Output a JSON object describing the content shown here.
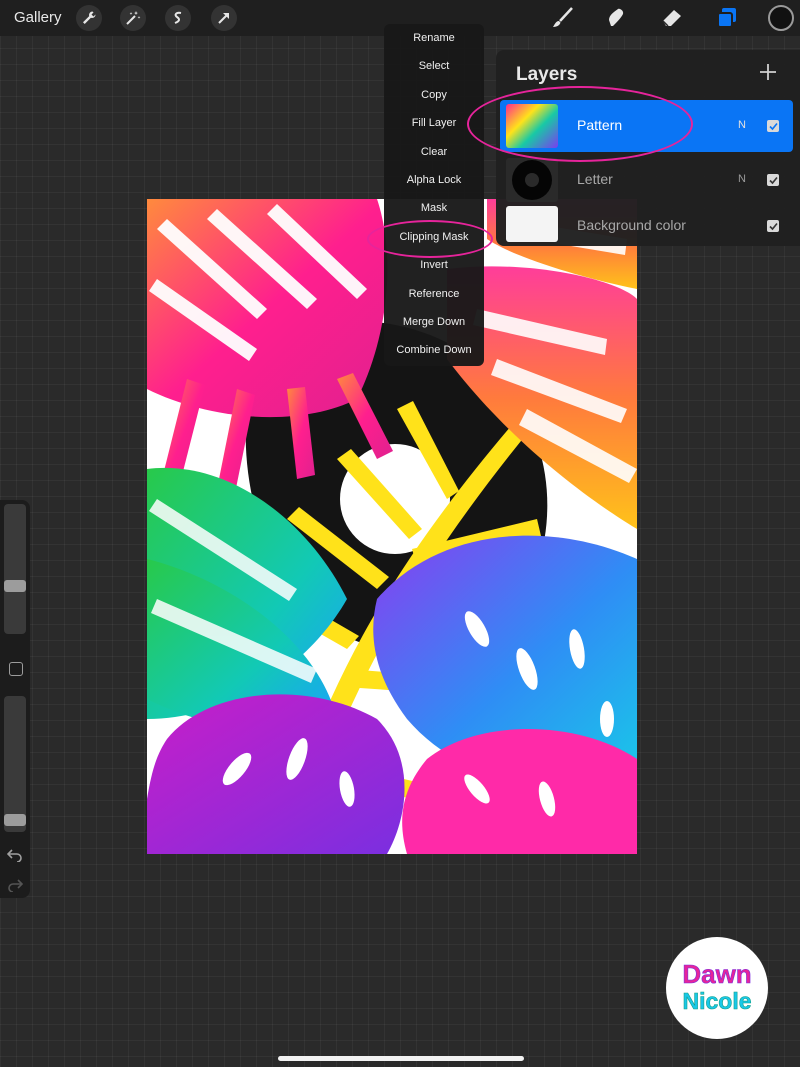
{
  "toolbar": {
    "gallery_label": "Gallery",
    "left_tools": [
      "wrench-icon",
      "magic-wand-icon",
      "selection-icon",
      "transform-arrow-icon"
    ],
    "right_tools": [
      "brush-icon",
      "smudge-icon",
      "eraser-icon",
      "layers-icon",
      "color-swatch"
    ],
    "active_color": "#111111"
  },
  "layer_menu": {
    "items": [
      "Rename",
      "Select",
      "Copy",
      "Fill Layer",
      "Clear",
      "Alpha Lock",
      "Mask",
      "Clipping Mask",
      "Invert",
      "Reference",
      "Merge Down",
      "Combine Down"
    ],
    "highlighted": "Clipping Mask"
  },
  "layers_panel": {
    "title": "Layers",
    "add_icon": "plus-icon",
    "layers": [
      {
        "name": "Pattern",
        "blend": "N",
        "visible": true,
        "selected": true
      },
      {
        "name": "Letter",
        "blend": "N",
        "visible": true,
        "selected": false
      },
      {
        "name": "Background color",
        "blend": "",
        "visible": true,
        "selected": false
      }
    ]
  },
  "sidebar": {
    "brush_size": 0.36,
    "opacity": 0.05,
    "tools": [
      "brush-size-slider",
      "modify-button",
      "opacity-slider",
      "undo-icon",
      "redo-icon"
    ]
  },
  "colors": {
    "accent_blue": "#0a75f5",
    "annotation_pink": "#e6249b"
  },
  "watermark": {
    "line1": "Dawn",
    "line2": "Nicole"
  }
}
